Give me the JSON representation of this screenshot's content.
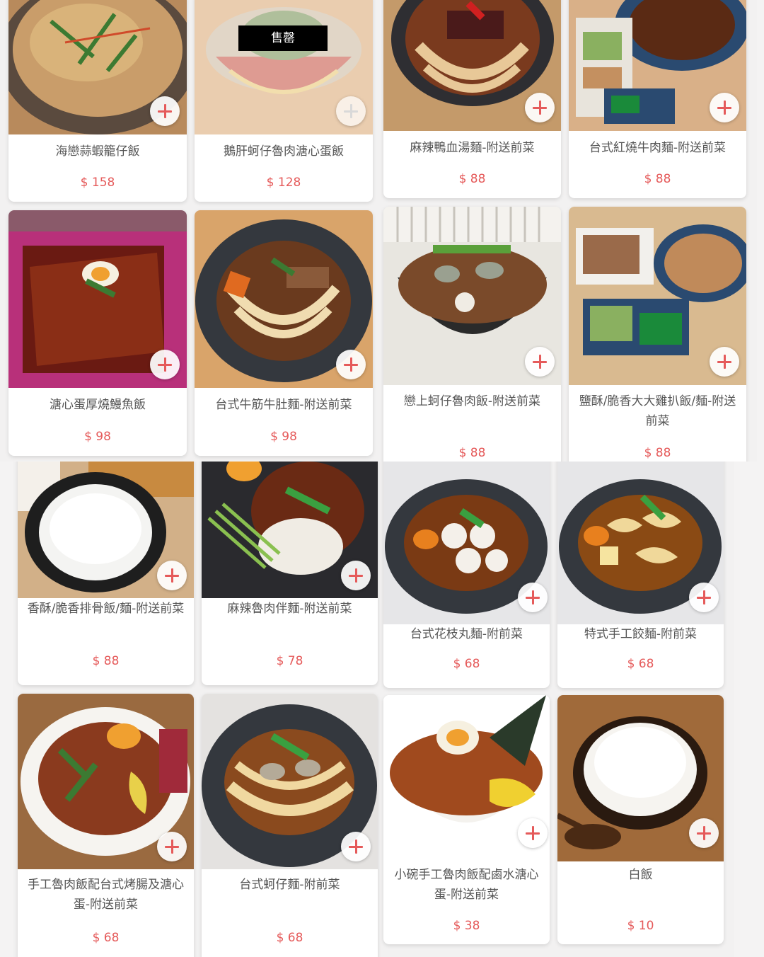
{
  "currency": "$",
  "sold_out_label": "售罄",
  "items": [
    {
      "name": "海戀蒜蝦籠仔飯",
      "price": "158"
    },
    {
      "name": "鵝肝蚵仔魯肉溏心蛋飯",
      "price": "128"
    },
    {
      "name": "麻辣鴨血湯麵-附送前菜",
      "price": "88"
    },
    {
      "name": "台式紅燒牛肉麵-附送前菜",
      "price": "88"
    },
    {
      "name": "溏心蛋厚燒鰻魚飯",
      "price": "98"
    },
    {
      "name": "台式牛筋牛肚麵-附送前菜",
      "price": "98"
    },
    {
      "name": "戀上蚵仔魯肉飯-附送前菜",
      "price": "88"
    },
    {
      "name": "鹽酥/脆香大大雞扒飯/麵-附送前菜",
      "price": "88"
    },
    {
      "name": "香酥/脆香排骨飯/麵-附送前菜",
      "price": "88"
    },
    {
      "name": "麻辣魯肉伴麵-附送前菜",
      "price": "78"
    },
    {
      "name": "台式花枝丸麵-附前菜",
      "price": "68"
    },
    {
      "name": "特式手工餃麵-附前菜",
      "price": "68"
    },
    {
      "name": "手工魯肉飯配台式烤腸及溏心蛋-附送前菜",
      "price": "68"
    },
    {
      "name": "台式蚵仔麵-附前菜",
      "price": "68"
    },
    {
      "name": "小碗手工魯肉飯配鹵水溏心蛋-附送前菜",
      "price": "38"
    },
    {
      "name": "白飯",
      "price": "10"
    }
  ],
  "colors": {
    "accent": "#e55a5a",
    "text": "#555555",
    "card": "#ffffff"
  }
}
